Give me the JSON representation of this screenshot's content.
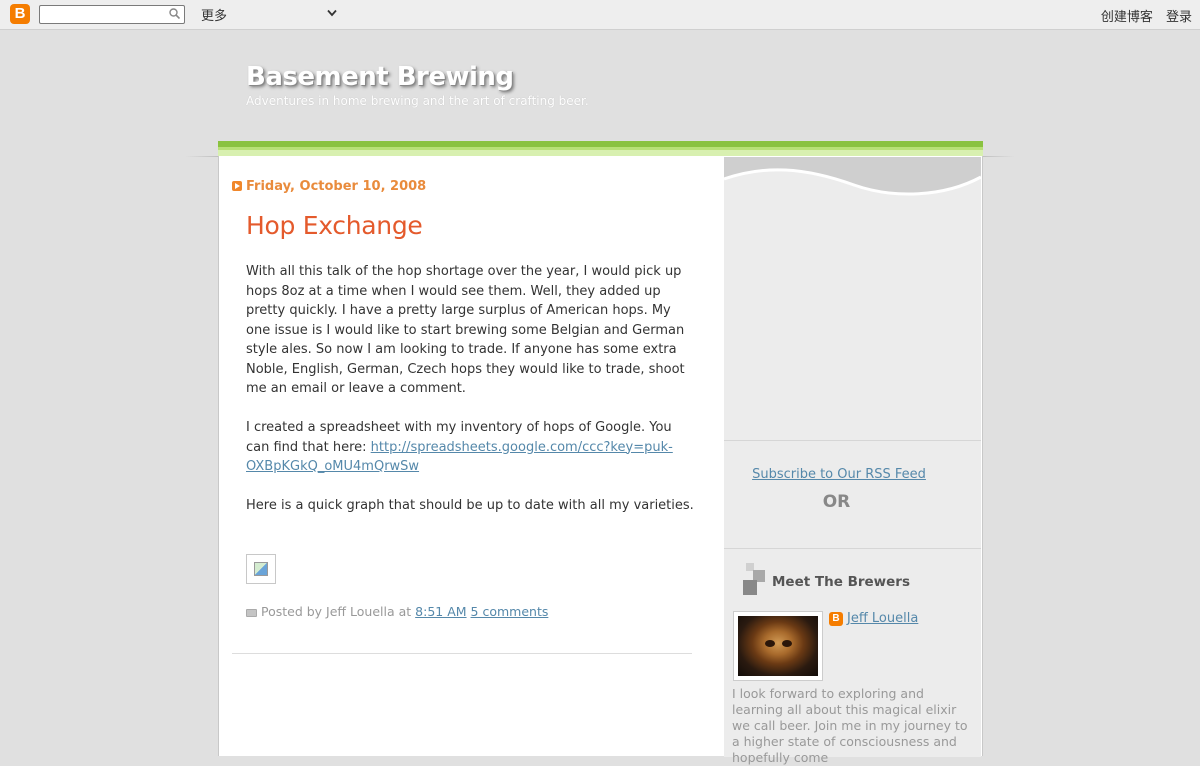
{
  "navbar": {
    "search_placeholder": "",
    "more_label": "更多",
    "create_blog_label": "创建博客",
    "login_label": "登录"
  },
  "header": {
    "title": "Basement Brewing",
    "description": "Adventures in home brewing and the art of crafting beer."
  },
  "post": {
    "date": "Friday, October 10, 2008",
    "title": "Hop Exchange",
    "paragraph1": "With all this talk of the hop shortage over the year, I would pick up hops 8oz at a time when I would see them. Well, they added up pretty quickly. I have a pretty large surplus of American hops. My one issue is I would like to start brewing some Belgian and German style ales. So now I am looking to trade. If anyone has some extra Noble, English, German, Czech hops they would like to trade, shoot me an email or leave a comment.",
    "paragraph2_text": "I created a spreadsheet with my inventory of hops of Google. You can find that here:",
    "paragraph2_link": "http://spreadsheets.google.com/ccc?key=puk-OXBpKGkQ_oMU4mQrwSw",
    "paragraph3": "Here is a quick graph that should be up to date with all my varieties.",
    "footer": {
      "posted_by": "Posted by Jeff Louella at",
      "time": "8:51 AM",
      "comments": "5 comments"
    }
  },
  "sidebar": {
    "rss_link": "Subscribe to Our RSS Feed",
    "or_text": "OR",
    "brewers_title": "Meet The Brewers",
    "profile_name": "Jeff Louella",
    "profile_bio": "I look forward to exploring and learning all about this magical elixir we call beer. Join me in my journey to a higher state of consciousness and hopefully come"
  },
  "colors": {
    "accent_orange": "#e45a2c",
    "date_orange": "#e98b3c",
    "link_blue": "#5588aa",
    "header_green": "#8ac240"
  }
}
